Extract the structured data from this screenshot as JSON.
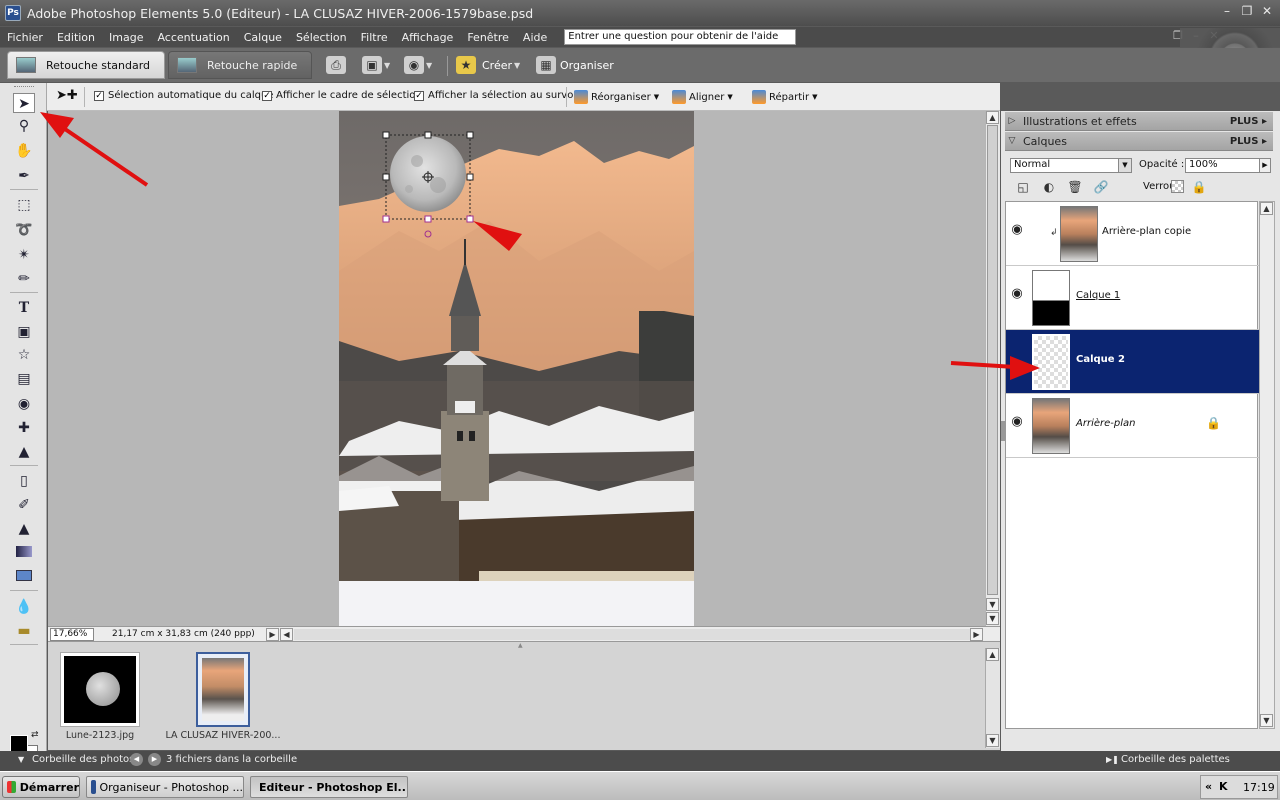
{
  "window": {
    "title": "Adobe Photoshop Elements 5.0 (Editeur) - LA CLUSAZ HIVER-2006-1579base.psd"
  },
  "menu": {
    "items": [
      "Fichier",
      "Edition",
      "Image",
      "Accentuation",
      "Calque",
      "Sélection",
      "Filtre",
      "Affichage",
      "Fenêtre",
      "Aide"
    ],
    "help_placeholder": "Entrer une question pour obtenir de l'aide"
  },
  "modebar": {
    "tab_standard": "Retouche standard",
    "tab_quick": "Retouche rapide",
    "create_label": "Créer",
    "organizer_label": "Organiser"
  },
  "options": {
    "auto_select": "Sélection automatique du calque",
    "show_bbox": "Afficher le cadre de sélection",
    "show_hover": "Afficher la sélection au survol",
    "arrange": "Réorganiser",
    "align": "Aligner",
    "distribute": "Répartir"
  },
  "status": {
    "zoom": "17,66%",
    "doc_size": "21,17 cm x 31,83 cm (240 ppp)"
  },
  "photobin": {
    "files": [
      {
        "name": "Lune-2123.jpg"
      },
      {
        "name": "LA CLUSAZ HIVER-200..."
      }
    ],
    "bin_label": "Corbeille des photos",
    "count_label": "3 fichiers dans la corbeille",
    "palette_bin_label": "Corbeille des palettes"
  },
  "palette": {
    "effects_title": "Illustrations et effets",
    "layers_title": "Calques",
    "plus": "PLUS",
    "blend_mode": "Normal",
    "opacity_label": "Opacité :",
    "opacity_value": "100%",
    "lock_label": "Verrou :",
    "layers": [
      {
        "name": "Arrière-plan copie",
        "selected": false
      },
      {
        "name": "Calque 1",
        "selected": false
      },
      {
        "name": "Calque 2",
        "selected": true
      },
      {
        "name": "Arrière-plan",
        "selected": false
      }
    ]
  },
  "taskbar": {
    "start": "Démarrer",
    "tasks": [
      "Organiseur - Photoshop ...",
      "Editeur - Photoshop El..."
    ],
    "clock": "17:19"
  },
  "colors": {
    "selected_layer": "#0b2470",
    "annotation_arrow": "#e01010"
  }
}
